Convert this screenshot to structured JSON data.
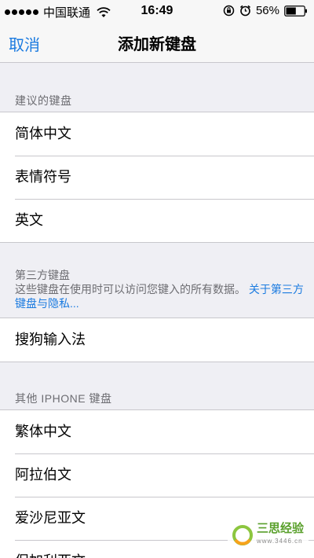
{
  "status_bar": {
    "carrier": "中国联通",
    "time": "16:49",
    "battery": "56%",
    "battery_level": 0.56
  },
  "nav": {
    "cancel_label": "取消",
    "title": "添加新键盘"
  },
  "suggested": {
    "header": "建议的键盘",
    "items": [
      {
        "label": "简体中文"
      },
      {
        "label": "表情符号"
      },
      {
        "label": "英文"
      }
    ]
  },
  "third_party": {
    "header": "第三方键盘",
    "description": "这些键盘在使用时可以访问您键入的所有数据。",
    "link": "关于第三方键盘与隐私...",
    "items": [
      {
        "label": "搜狗输入法"
      }
    ]
  },
  "other": {
    "header": "其他 IPHONE 键盘",
    "items": [
      {
        "label": "繁体中文"
      },
      {
        "label": "阿拉伯文"
      },
      {
        "label": "爱沙尼亚文"
      },
      {
        "label": "保加利亚文"
      }
    ]
  },
  "watermark": {
    "text": "三思经验",
    "sub": "www.3446.cn"
  }
}
